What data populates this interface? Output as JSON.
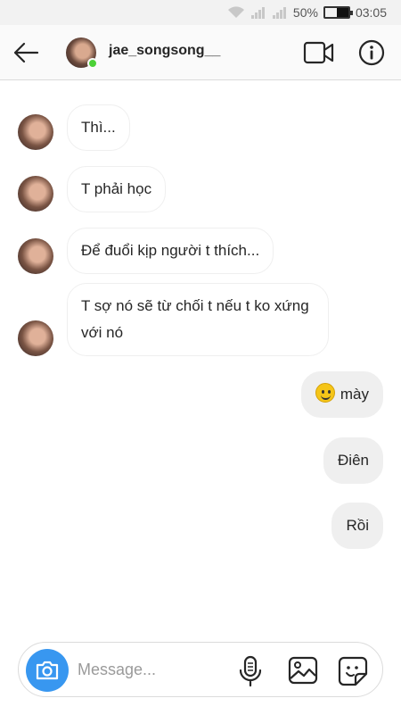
{
  "status_bar": {
    "battery_percent": "50%",
    "time": "03:05",
    "icons": [
      "wifi-icon",
      "signal-icon",
      "signal-icon",
      "battery-icon"
    ]
  },
  "header": {
    "username": "jae_songsong__",
    "online": true,
    "icons": [
      "back-arrow-icon",
      "video-call-icon",
      "info-icon"
    ]
  },
  "messages": [
    {
      "sender": "them",
      "text": "Thì..."
    },
    {
      "sender": "them",
      "text": "T phải học"
    },
    {
      "sender": "them",
      "text": "Để đuổi kịp người t thích..."
    },
    {
      "sender": "them",
      "text": "T sợ nó sẽ từ chối t nếu t ko xứng với nó"
    },
    {
      "sender": "me",
      "text": "mày",
      "emoji": "slightly-smiling-face"
    },
    {
      "sender": "me",
      "text": "Điên"
    },
    {
      "sender": "me",
      "text": "Rồi"
    }
  ],
  "composer": {
    "placeholder": "Message...",
    "value": "",
    "icons": [
      "camera-icon",
      "microphone-icon",
      "gallery-icon",
      "sticker-icon"
    ]
  },
  "colors": {
    "accent": "#3897f0",
    "online": "#4cd137",
    "my_bubble": "#efefef",
    "their_bubble_border": "#efefef"
  }
}
